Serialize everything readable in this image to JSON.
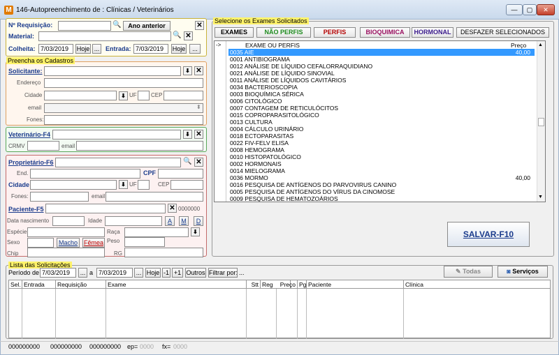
{
  "window": {
    "title": "146-Autopreenchimento de : Clínicas / Veterinários",
    "icon_letter": "M",
    "minimize": "—",
    "maximize": "▢",
    "close": "✕"
  },
  "requisicao": {
    "nreq_label": "Nº Requisição:",
    "ano_anterior": "Ano anterior",
    "material_label": "Material:",
    "colheita_label": "Colheita:",
    "colheita_date": "7/03/2019",
    "hoje": "Hoje",
    "dots": "...",
    "entrada_label": "Entrada:",
    "entrada_date": "7/03/2019"
  },
  "cadastros": {
    "title": "Preencha os Cadastros",
    "solicitante": "Solicitante:",
    "endereco": "Endereço",
    "cidade": "Cidade",
    "uf": "UF",
    "cep": "CEP",
    "email": "email",
    "fones": "Fones:"
  },
  "veterinario": {
    "label": "Veterinário-F4",
    "crmv": "CRMV",
    "email": "email"
  },
  "proprietario": {
    "label": "Proprietário-F6",
    "end": "End.",
    "cpf": "CPF",
    "cidade": "Cidade",
    "uf": "UF",
    "cep": "CEP",
    "fones": "Fones:",
    "email": "email",
    "paciente": "Paciente-F5",
    "paciente_code": "0000000",
    "data_nasc": "Data nascimento",
    "idade": "Idade",
    "a": "A",
    "m": "M",
    "d": "D",
    "especie": "Espécie",
    "raca": "Raça",
    "sexo": "Sexo",
    "macho": "Macho",
    "femea": "Fêmea",
    "peso": "Peso",
    "chip": "Chip",
    "rg": "RG"
  },
  "exames": {
    "title": "Selecione os Exames Solicitados",
    "tabs": [
      "EXAMES",
      "NÃO PERFIS",
      "PERFIS",
      "BIOQUIMICA",
      "HORMONAL",
      "DESFAZER SELECIONADOS"
    ],
    "tab_colors": [
      "#000000",
      "#1d8a1d",
      "#b30000",
      "#9a1060",
      "#3a1a8c",
      "#000000"
    ],
    "header_arrow": "->",
    "header_name": "EXAME OU PERFIS",
    "header_price": "Preço",
    "items": [
      {
        "name": "0035 AIE",
        "price": "40,00"
      },
      {
        "name": "0001 ANTIBIOGRAMA",
        "price": ""
      },
      {
        "name": "0012 ANÁLISE DE LÍQUIDO CEFALORRAQUIDIANO",
        "price": ""
      },
      {
        "name": "0021 ANÁLISE DE LÍQUIDO SINOVIAL",
        "price": ""
      },
      {
        "name": "0011 ANÁLISE DE LÍQUIDOS CAVITÁRIOS",
        "price": ""
      },
      {
        "name": "0034 BACTERIOSCOPIA",
        "price": ""
      },
      {
        "name": "0003 BIOQUÍMICA SÉRICA",
        "price": ""
      },
      {
        "name": "0006 CITOLÓGICO",
        "price": ""
      },
      {
        "name": "0007 CONTAGEM DE RETICULÓCITOS",
        "price": ""
      },
      {
        "name": "0015 COPROPARASITOLÓGICO",
        "price": ""
      },
      {
        "name": "0013 CULTURA",
        "price": ""
      },
      {
        "name": "0004 CÁLCULO URINÁRIO",
        "price": ""
      },
      {
        "name": "0018 ECTOPARASITAS",
        "price": ""
      },
      {
        "name": "0022 FIV-FELV ELISA",
        "price": ""
      },
      {
        "name": "0008 HEMOGRAMA",
        "price": ""
      },
      {
        "name": "0010 HISTOPATOLÓGICO",
        "price": ""
      },
      {
        "name": "0002 HORMONAIS",
        "price": ""
      },
      {
        "name": "0014 MIELOGRAMA",
        "price": ""
      },
      {
        "name": "0036 MORMO",
        "price": "40,00"
      },
      {
        "name": "0016 PESQUISA DE ANTÍGENOS DO PARVOVIRUS CANINO",
        "price": ""
      },
      {
        "name": "0005 PESQUISA DE ANTÍGENOS DO VÍRUS DA CINOMOSE",
        "price": ""
      },
      {
        "name": "0009 PESQUISA DE HEMATOZOÁRIOS",
        "price": ""
      }
    ],
    "salvar": "SALVAR-F10"
  },
  "solicitacoes": {
    "title": "Lista das Solicitações",
    "periodo": "Período de",
    "date_from": "7/03/2019",
    "a": "a",
    "date_to": "7/03/2019",
    "hoje": "Hoje",
    "minus1": "-1",
    "plus1": "+1",
    "outros": "Outros",
    "filtrar": "Filtrar por:",
    "dots": "...",
    "todas": "Todas",
    "servicos": "Serviços",
    "columns": [
      "Sel.",
      "Entrada",
      "Requisição",
      "Exame",
      "Stt",
      "Reg",
      "Preço",
      "Pg",
      "Paciente",
      "Clínica"
    ]
  },
  "statusbar": {
    "c1": "000000000",
    "c2": "000000000",
    "c3": "000000000",
    "ep_label": "ep=",
    "ep_val": "0000",
    "fx_label": "fx=",
    "fx_val": "0000"
  }
}
